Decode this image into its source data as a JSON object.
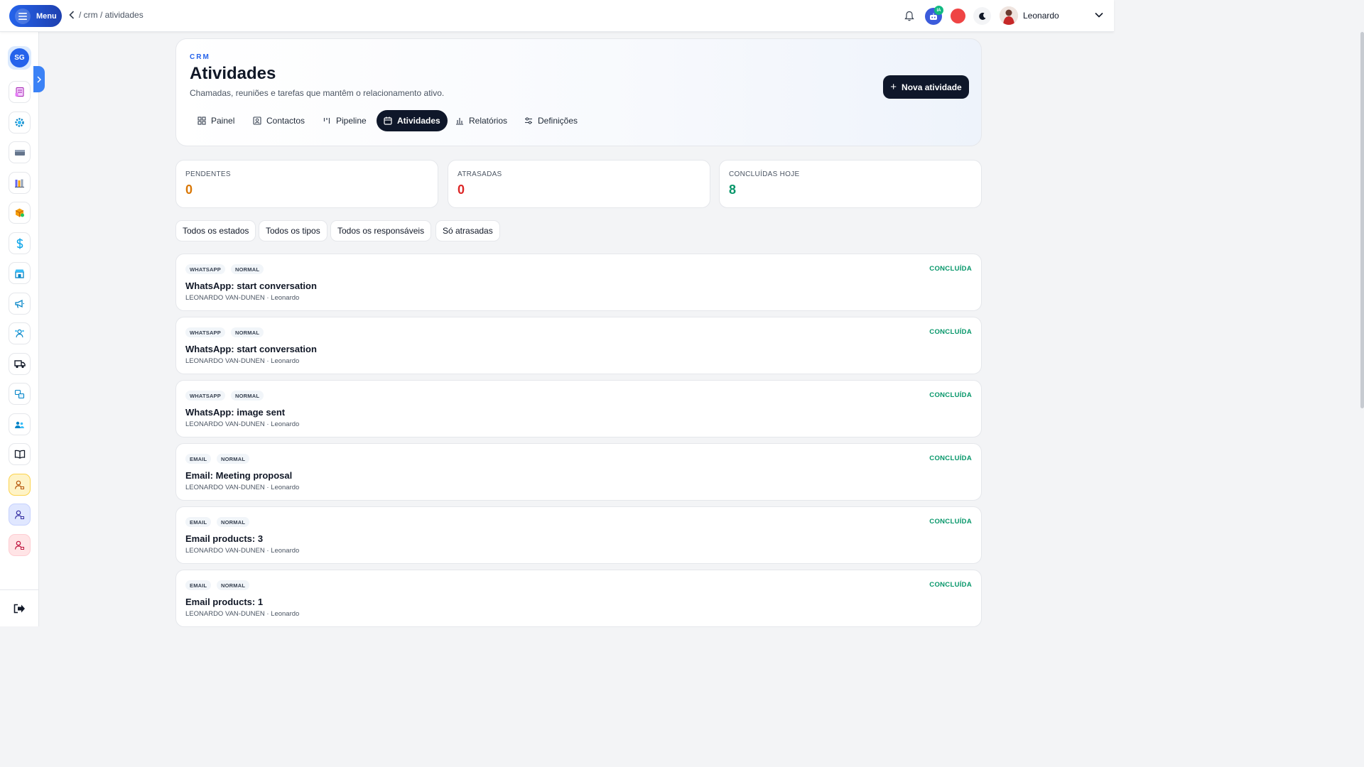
{
  "topbar": {
    "menu_label": "Menu",
    "breadcrumb": "/ crm / atividades",
    "ia_badge": "IA",
    "user_name": "Leonardo"
  },
  "sidebar": {
    "avatar_initials": "SG",
    "items": [
      "invoice-icon",
      "gear-icon",
      "layout-icon",
      "books-icon",
      "box-icon",
      "dollar-icon",
      "store-icon",
      "megaphone-icon",
      "team-icon",
      "truck-icon",
      "translate-icon",
      "users-icon",
      "book-icon",
      "user-yellow-icon",
      "user-blue-icon",
      "user-red-icon"
    ],
    "logout_icon": "logout-icon"
  },
  "header": {
    "eyebrow": "CRM",
    "title": "Atividades",
    "subtitle": "Chamadas, reuniões e tarefas que mantêm o relacionamento ativo.",
    "new_button": "Nova atividade",
    "tabs": [
      {
        "label": "Painel",
        "icon": "grid-icon"
      },
      {
        "label": "Contactos",
        "icon": "contact-icon"
      },
      {
        "label": "Pipeline",
        "icon": "pipeline-icon"
      },
      {
        "label": "Atividades",
        "icon": "calendar-icon",
        "active": true
      },
      {
        "label": "Relatórios",
        "icon": "chart-icon"
      },
      {
        "label": "Definições",
        "icon": "sliders-icon"
      }
    ]
  },
  "stats": [
    {
      "label": "PENDENTES",
      "value": "0",
      "color": "#d97706"
    },
    {
      "label": "ATRASADAS",
      "value": "0",
      "color": "#dc2626"
    },
    {
      "label": "CONCLUÍDAS HOJE",
      "value": "8",
      "color": "#059669"
    }
  ],
  "filters": [
    "Todos os estados",
    "Todos os tipos",
    "Todos os responsáveis",
    "Só atrasadas"
  ],
  "activities": [
    {
      "type": "WHATSAPP",
      "priority": "NORMAL",
      "title": "WhatsApp: start conversation",
      "meta": "LEONARDO VAN-DUNEN · Leonardo",
      "status": "CONCLUÍDA"
    },
    {
      "type": "WHATSAPP",
      "priority": "NORMAL",
      "title": "WhatsApp: start conversation",
      "meta": "LEONARDO VAN-DUNEN · Leonardo",
      "status": "CONCLUÍDA"
    },
    {
      "type": "WHATSAPP",
      "priority": "NORMAL",
      "title": "WhatsApp: image sent",
      "meta": "LEONARDO VAN-DUNEN · Leonardo",
      "status": "CONCLUÍDA"
    },
    {
      "type": "EMAIL",
      "priority": "NORMAL",
      "title": "Email: Meeting proposal",
      "meta": "LEONARDO VAN-DUNEN · Leonardo",
      "status": "CONCLUÍDA"
    },
    {
      "type": "EMAIL",
      "priority": "NORMAL",
      "title": "Email products: 3",
      "meta": "LEONARDO VAN-DUNEN · Leonardo",
      "status": "CONCLUÍDA"
    },
    {
      "type": "EMAIL",
      "priority": "NORMAL",
      "title": "Email products: 1",
      "meta": "LEONARDO VAN-DUNEN · Leonardo",
      "status": "CONCLUÍDA"
    }
  ],
  "colors": {
    "accent": "#2563eb",
    "dark": "#0f172a",
    "success": "#059669"
  }
}
